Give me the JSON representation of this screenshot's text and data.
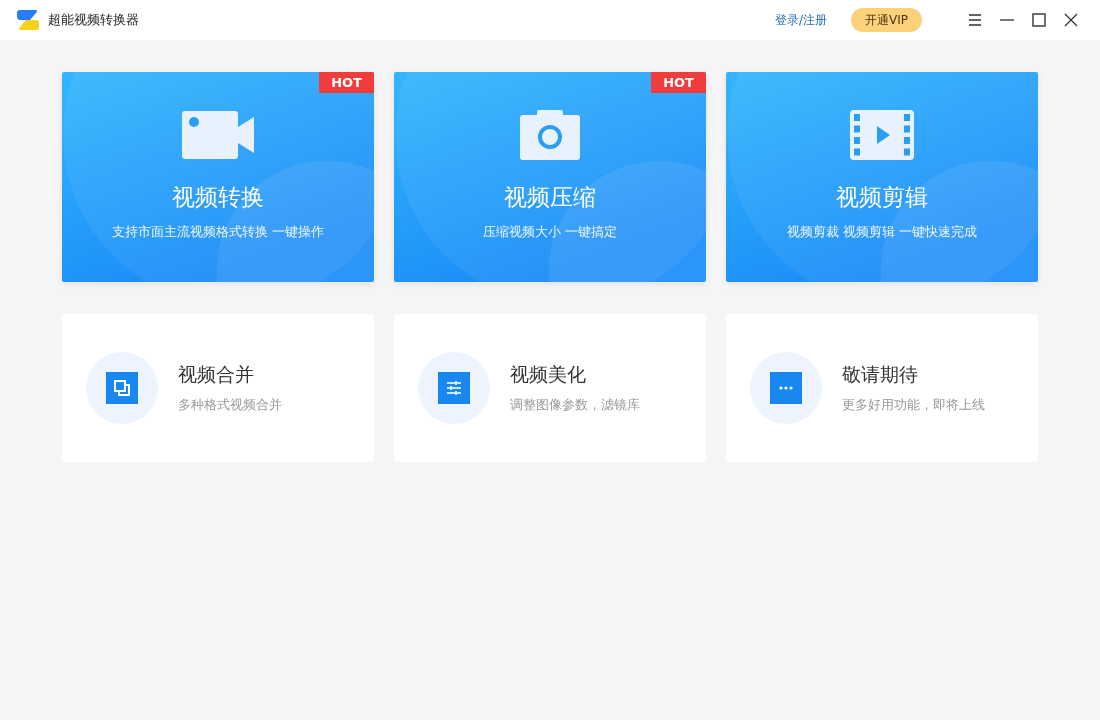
{
  "window": {
    "title": "超能视频转换器"
  },
  "header": {
    "login_link": "登录/注册",
    "vip_button": "开通VIP"
  },
  "feature_cards": [
    {
      "title": "视频转换",
      "subtitle": "支持市面主流视频格式转换 一键操作",
      "kind": "videocamera",
      "hot": true,
      "badge": "HOT"
    },
    {
      "title": "视频压缩",
      "subtitle": "压缩视频大小 一键搞定",
      "kind": "camera",
      "hot": true,
      "badge": "HOT"
    },
    {
      "title": "视频剪辑",
      "subtitle": "视频剪裁 视频剪辑 一键快速完成",
      "kind": "film",
      "hot": false
    }
  ],
  "tool_cards": [
    {
      "title": "视频合并",
      "subtitle": "多种格式视频合并",
      "kind": "merge"
    },
    {
      "title": "视频美化",
      "subtitle": "调整图像参数，滤镜库",
      "kind": "sliders"
    },
    {
      "title": "敬请期待",
      "subtitle": "更多好用功能，即将上线",
      "kind": "more"
    }
  ]
}
